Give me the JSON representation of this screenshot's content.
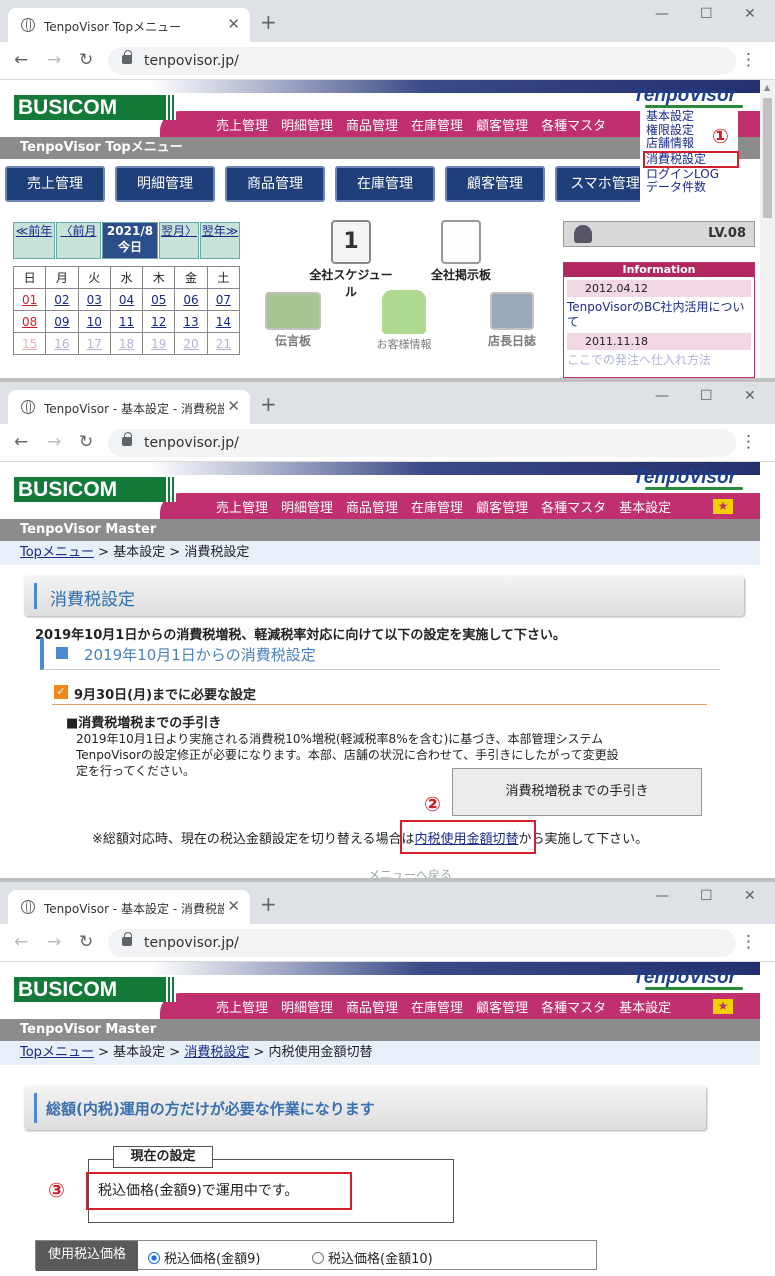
{
  "screens": [
    {
      "tab_title": "TenpoVisor Topメニュー",
      "url": "tenpovisor.jp/",
      "header_menu": [
        "売上管理",
        "明細管理",
        "商品管理",
        "在庫管理",
        "顧客管理",
        "各種マスタ"
      ],
      "gray_bar": "TenpoVisor Topメニュー",
      "big_menu": [
        "売上管理",
        "明細管理",
        "商品管理",
        "在庫管理",
        "顧客管理",
        "スマホ管理"
      ],
      "dropdown": [
        "基本設定",
        "権限設定",
        "店舗情報",
        "消費税設定",
        "ログインLOG",
        "データ件数"
      ],
      "marker": "①",
      "calendar": {
        "prev_year": "≪前年",
        "prev_month": "〈前月",
        "current": "2021/8",
        "today": "今日",
        "next_month": "翌月〉",
        "next_year": "翌年≫",
        "dow": [
          "日",
          "月",
          "火",
          "水",
          "木",
          "金",
          "土"
        ],
        "week1": [
          "01",
          "02",
          "03",
          "04",
          "05",
          "06",
          "07"
        ],
        "week2": [
          "08",
          "09",
          "10",
          "11",
          "12",
          "13",
          "14"
        ],
        "week3": [
          "15",
          "16",
          "17",
          "18",
          "19",
          "20",
          "21"
        ]
      },
      "icons": {
        "schedule": "全社スケジュール",
        "board": "全社掲示板",
        "memo": "伝言板",
        "customer": "お客様情報",
        "diary": "店長日誌",
        "schedule_num": "1"
      },
      "level": "LV.08",
      "info": {
        "header": "Information",
        "date1": "2012.04.12",
        "link1": "TenpoVisorのBC社内活用について",
        "date2": "2011.11.18",
        "link2": "ここでの発注へ仕入れ方法"
      }
    },
    {
      "tab_title": "TenpoVisor - 基本設定 - 消費税設定",
      "url": "tenpovisor.jp/",
      "header_menu": [
        "売上管理",
        "明細管理",
        "商品管理",
        "在庫管理",
        "顧客管理",
        "各種マスタ",
        "基本設定"
      ],
      "gray_bar": "TenpoVisor Master",
      "breadcrumb": {
        "top": "Topメニュー",
        "sep": " > ",
        "mid": "基本設定",
        "cur": "消費税設定"
      },
      "title": "消費税設定",
      "intro": "2019年10月1日からの消費税増税、軽減税率対応に向けて以下の設定を実施して下さい。",
      "subheading": "2019年10月1日からの消費税設定",
      "check_label": "9月30日(月)までに必要な設定",
      "guide_heading": "■消費税増税までの手引き",
      "guide_text1": "2019年10月1日より実施される消費税10%増税(軽減税率8%を含む)に基づき、本部管理システム",
      "guide_text2": "TenpoVisorの設定修正が必要になります。本部、店舗の状況に合わせて、手引きにしたがって変更設",
      "guide_text3": "定を行ってください。",
      "guide_button": "消費税増税までの手引き",
      "marker": "②",
      "note_before": "※総額対応時、現在の税込金額設定を切り替える場合は",
      "note_link": "内税使用金額切替",
      "note_after": "から実施して下さい。",
      "back": "メニューへ戻る"
    },
    {
      "tab_title": "TenpoVisor - 基本設定 - 消費税設定",
      "url": "tenpovisor.jp/",
      "header_menu": [
        "売上管理",
        "明細管理",
        "商品管理",
        "在庫管理",
        "顧客管理",
        "各種マスタ",
        "基本設定"
      ],
      "gray_bar": "TenpoVisor Master",
      "breadcrumb": {
        "top": "Topメニュー",
        "sep": " > ",
        "mid": "基本設定",
        "link2": "消費税設定",
        "cur": "内税使用金額切替"
      },
      "title": "総額(内税)運用の方だけが必要な作業になります",
      "legend": "現在の設定",
      "marker": "③",
      "status": "税込価格(金額9)で運用中です。",
      "price_label": "使用税込価格",
      "option1": "税込価格(金額9)",
      "option2": "税込価格(金額10)"
    }
  ],
  "colors": {
    "accent_red": "#d31e2b",
    "brand_green": "#147a3a",
    "magenta": "#c0306e",
    "navy": "#1f3f7a"
  }
}
